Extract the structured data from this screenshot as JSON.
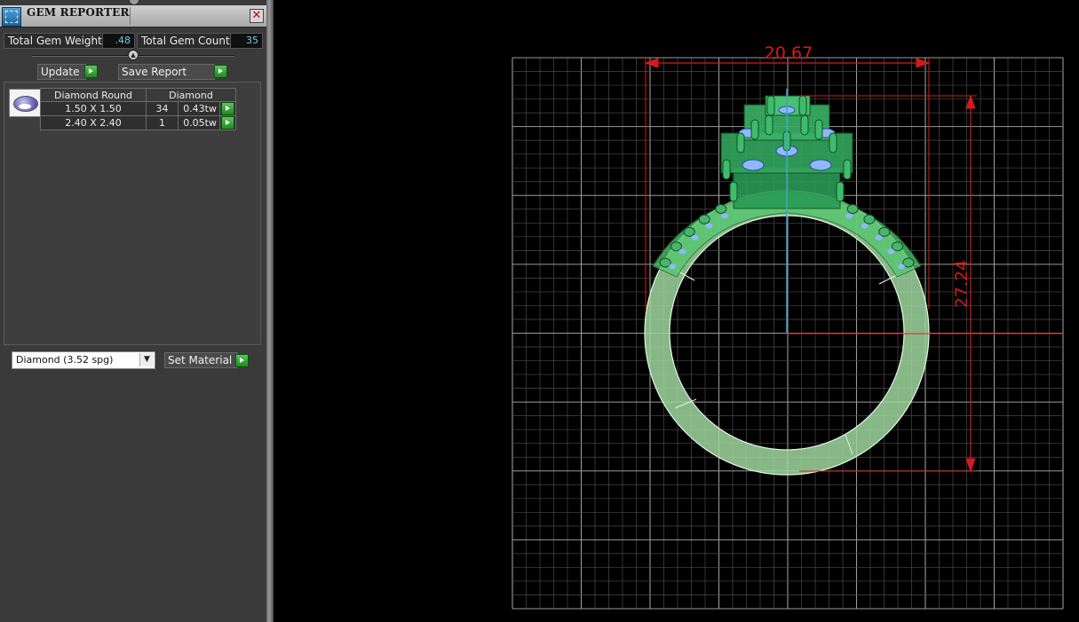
{
  "window": {
    "title": "GEM REPORTER",
    "close_glyph": "✕",
    "app_icon": "gem-reporter-icon"
  },
  "totals": {
    "weight_label": "Total Gem Weight",
    "weight_value": ".48",
    "count_label": "Total Gem Count",
    "count_value": "35"
  },
  "buttons": {
    "update": "Update",
    "save_report": "Save Report",
    "set_material": "Set Material"
  },
  "gem_list": {
    "headers": [
      "Diamond Round",
      "Diamond"
    ],
    "rows": [
      {
        "size": "1.50 X 1.50",
        "count": "34",
        "weight": "0.43tw"
      },
      {
        "size": "2.40 X 2.40",
        "count": "1",
        "weight": "0.05tw"
      }
    ]
  },
  "material": {
    "selected": "Diamond     (3.52 spg)"
  },
  "viewport": {
    "dimension_width": "20.67",
    "dimension_height": "27.24",
    "colors": {
      "grid": "#7a7a7a",
      "dimension": "#d01c1c",
      "axis": "#3aa7c9",
      "band": "#bde8bd",
      "head": "#2f9a55"
    }
  }
}
